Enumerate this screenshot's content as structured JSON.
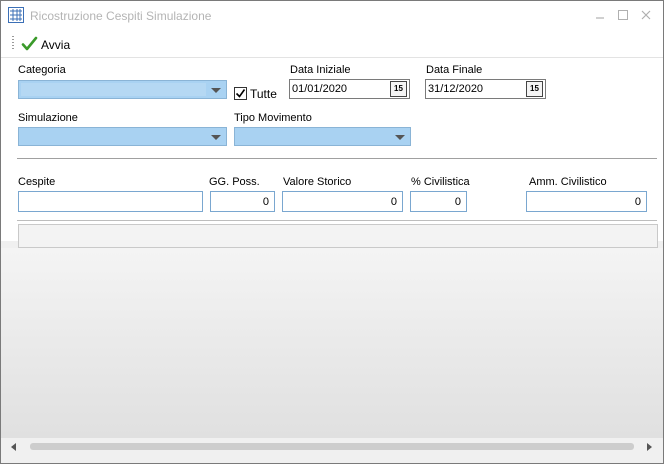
{
  "window": {
    "title": "Ricostruzione Cespiti Simulazione"
  },
  "toolbar": {
    "avvia_label": "Avvia"
  },
  "filters": {
    "categoria_label": "Categoria",
    "tutte_label": "Tutte",
    "tutte_checked": true,
    "data_iniziale_label": "Data Iniziale",
    "data_iniziale_value": "01/01/2020",
    "data_finale_label": "Data Finale",
    "data_finale_value": "31/12/2020",
    "calendar_icon_text": "15",
    "simulazione_label": "Simulazione",
    "tipo_movimento_label": "Tipo Movimento"
  },
  "details": {
    "cespite_label": "Cespite",
    "gg_poss_label": "GG.  Poss.",
    "gg_poss_value": "0",
    "valore_storico_label": "Valore Storico",
    "valore_storico_value": "0",
    "perc_civilistica_label": "% Civilistica",
    "perc_civilistica_value": "0",
    "amm_civilistico_label": "Amm. Civilistico",
    "amm_civilistico_value": "0"
  },
  "colors": {
    "combo_bg": "#a9d2f2",
    "accent_check": "#3a9a2a",
    "title_text": "#b4b4b4"
  },
  "icons": {
    "app": "grid-app-icon",
    "run": "checkmark-icon",
    "calendar": "calendar-icon"
  }
}
